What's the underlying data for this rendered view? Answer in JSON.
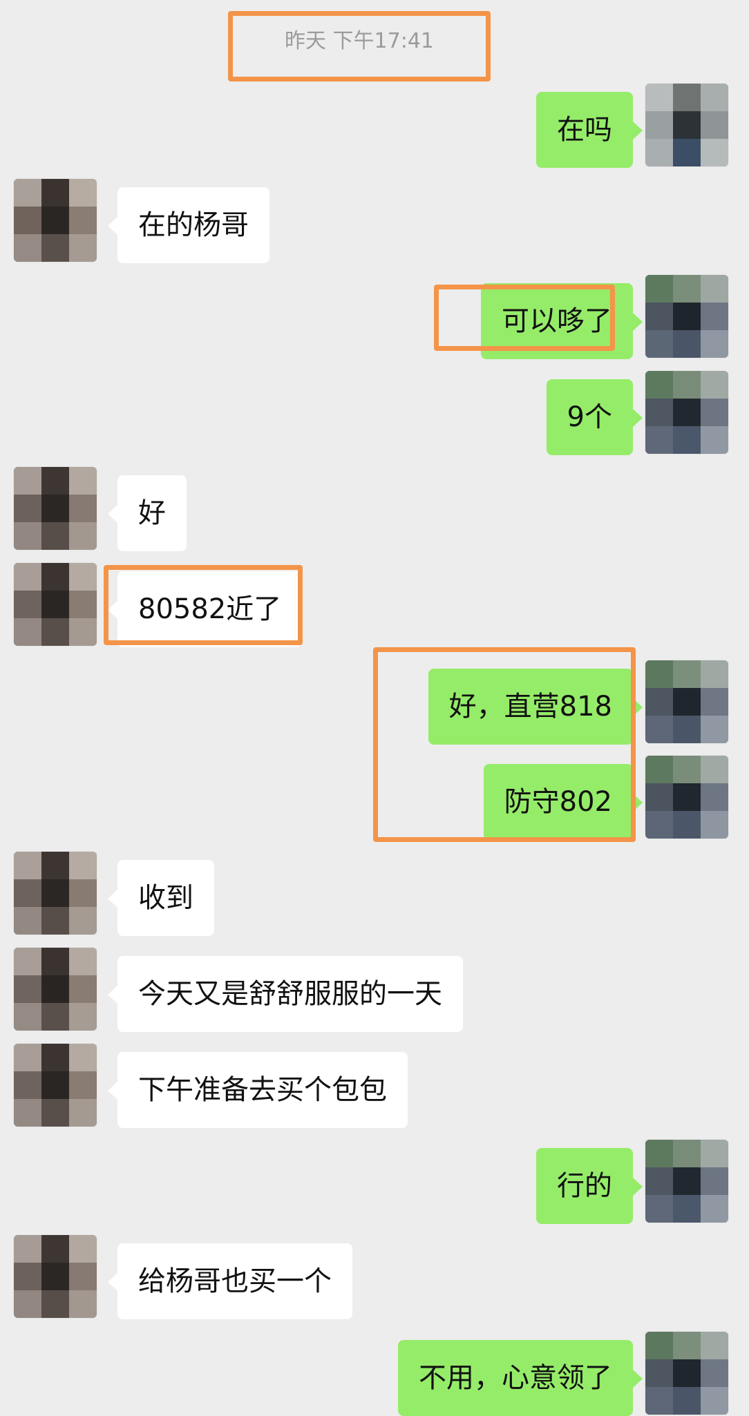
{
  "timestamp": "昨天 下午17:41",
  "colors": {
    "background": "#ededed",
    "bubble_me": "#95ec69",
    "bubble_other": "#ffffff",
    "highlight": "#f39449"
  },
  "messages": [
    {
      "side": "right",
      "text": "在吗"
    },
    {
      "side": "left",
      "text": "在的杨哥"
    },
    {
      "side": "right",
      "text": "可以哆了"
    },
    {
      "side": "right",
      "text": "9个"
    },
    {
      "side": "left",
      "text": "好"
    },
    {
      "side": "left",
      "text": "80582近了"
    },
    {
      "side": "right",
      "text": "好，直营818"
    },
    {
      "side": "right",
      "text": "防守802"
    },
    {
      "side": "left",
      "text": "收到"
    },
    {
      "side": "left",
      "text": "今天又是舒舒服服的一天"
    },
    {
      "side": "left",
      "text": "下午准备去买个包包"
    },
    {
      "side": "right",
      "text": "行的"
    },
    {
      "side": "left",
      "text": "给杨哥也买一个"
    },
    {
      "side": "right",
      "text": "不用，心意领了"
    }
  ],
  "icons": {
    "avatar_self": "pixelated-avatar-icon",
    "avatar_other": "pixelated-avatar-icon"
  }
}
